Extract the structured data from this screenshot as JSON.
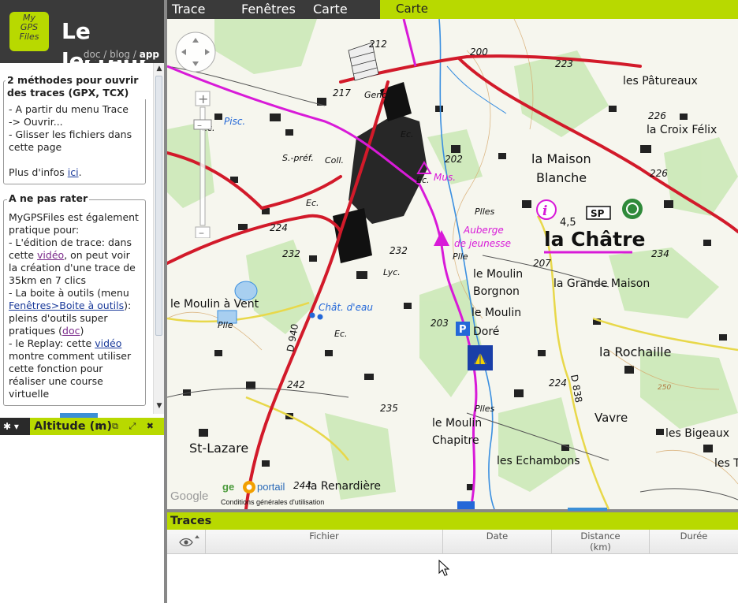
{
  "app": {
    "logo": [
      "My",
      "GPS",
      "Files"
    ],
    "title": "Le",
    "subtitle": "lecteur",
    "links": {
      "doc": "doc",
      "sep1": " / ",
      "blog": "blog",
      "sep2": " / ",
      "app": "app"
    }
  },
  "menu": {
    "trace": "Trace",
    "fenetres": "Fenêtres",
    "carte": "Carte",
    "carte_tab": "Carte"
  },
  "info": {
    "box1": {
      "title": "2 méthodes pour ouvrir des traces (GPX, TCX)",
      "lines": [
        "- A partir du menu Trace",
        "-> Ouvrir...",
        "- Glisser les fichiers dans cette page"
      ],
      "more_prefix": "Plus d'infos ",
      "more_link": "ici",
      "more_suffix": "."
    },
    "box2": {
      "title": "A ne pas rater",
      "intro": "MyGPSFiles est également pratique pour:",
      "p1_a": "- L'édition de trace: dans cette ",
      "p1_link": "vidéo",
      "p1_b": ", on peut voir la création d'une trace de 35km en 7 clics",
      "p2_a": "- La boite à outils (menu ",
      "p2_link": "Fenêtres>Boite à outils",
      "p2_b": "): pleins d'outils super pratiques (",
      "p2_link2": "doc",
      "p2_c": ")",
      "p3_a": "- le Replay: cette ",
      "p3_link": "vidéo",
      "p3_b": " montre comment utiliser cette fonction pour réaliser une course virtuelle"
    }
  },
  "altitude": {
    "tools": "✱ ▾",
    "title": "Altitude (m)",
    "icons": "⤓ ⧉ ⤢ ✖"
  },
  "map": {
    "labels": {
      "les_patureaux": "les Pâtureaux",
      "la_croix_felix": "la Croix Félix",
      "la_maison": "la Maison",
      "blanche": "Blanche",
      "la_chatre": "la Châtre",
      "la_grande_maison": "la Grande Maison",
      "la_rochaille": "la Rochaille",
      "vavre": "Vavre",
      "les_bigeaux": "les Bigeaux",
      "les_tu": "les Tu",
      "les_echambons": "les Echambons",
      "le_moulin_chapitre1": "le Moulin",
      "le_moulin_chapitre2": "Chapitre",
      "le_moulin_dore1": "le Moulin",
      "le_moulin_dore2": "Doré",
      "le_moulin_borgnon1": "le Moulin",
      "le_moulin_borgnon2": "Borgnon",
      "le_moulin_a_vent": "le Moulin à Vent",
      "st_lazare": "St-Lazare",
      "la_renardiere": "la Renardière",
      "auberge1": "Auberge",
      "auberge2": "de jeunesse",
      "mus": "Mus.",
      "piscine": "Pisc.",
      "chateau_eau": "Chât. d'eau",
      "plles1": "Plles",
      "plles2": "Plles",
      "plle1": "Plle",
      "plle2": "Plle",
      "coll": "Coll.",
      "spref": "S.-préf.",
      "gend": "Gend.",
      "lyc": "Lyc.",
      "ec1": "Ec.",
      "ec2": "Ec.",
      "ec3": "Ec.",
      "ec4": "Ec.",
      "ec5": "Ec.",
      "d940": "D 940",
      "d838": "D 838",
      "info_45": "4,5",
      "sp": "SP",
      "alt_212": "212",
      "alt_200": "200",
      "alt_223": "223",
      "alt_226": "226",
      "alt_226b": "226",
      "alt_217": "217",
      "alt_202": "202",
      "alt_224": "224",
      "alt_224b": "224",
      "alt_232": "232",
      "alt_232b": "232",
      "alt_234": "234",
      "alt_207": "207",
      "alt_203": "203",
      "alt_242": "242",
      "alt_235": "235",
      "alt_244": "244",
      "alt_250": "250",
      "google": "Google",
      "geoportail_geo": "ge",
      "geoportail_portail": "portail",
      "conditions": "Conditions générales d'utilisation"
    }
  },
  "traces": {
    "title": "Traces",
    "columns": {
      "fichier": "Fichier",
      "date": "Date",
      "distance": "Distance",
      "distance_unit": "(km)",
      "duree": "Durée"
    }
  }
}
